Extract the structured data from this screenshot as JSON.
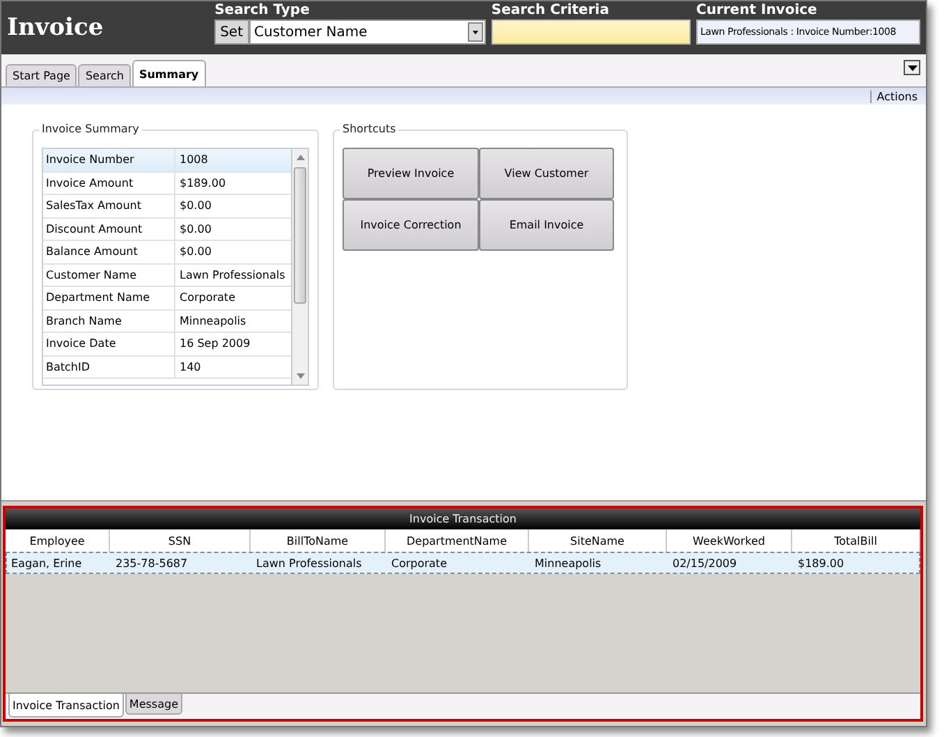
{
  "header": {
    "title": "Invoice",
    "search_type": {
      "label": "Search Type",
      "set_button": "Set",
      "value": "Customer Name"
    },
    "search_criteria": {
      "label": "Search Criteria"
    },
    "current_invoice": {
      "label": "Current Invoice",
      "value": "Lawn Professionals : Invoice Number:1008"
    }
  },
  "tabs": [
    {
      "label": "Start Page",
      "selected": false
    },
    {
      "label": "Search",
      "selected": false
    },
    {
      "label": "Summary",
      "selected": true
    }
  ],
  "actions_label": "Actions",
  "invoice_summary": {
    "title": "Invoice Summary",
    "rows": [
      {
        "name": "Invoice Number",
        "value": "1008",
        "selected": true
      },
      {
        "name": "Invoice Amount",
        "value": "$189.00",
        "selected": false
      },
      {
        "name": "SalesTax Amount",
        "value": "$0.00",
        "selected": false
      },
      {
        "name": "Discount Amount",
        "value": "$0.00",
        "selected": false
      },
      {
        "name": "Balance Amount",
        "value": "$0.00",
        "selected": false
      },
      {
        "name": "Customer Name",
        "value": "Lawn Professionals",
        "selected": false
      },
      {
        "name": "Department Name",
        "value": "Corporate",
        "selected": false
      },
      {
        "name": "Branch Name",
        "value": "Minneapolis",
        "selected": false
      },
      {
        "name": "Invoice Date",
        "value": "16 Sep 2009",
        "selected": false
      },
      {
        "name": "BatchID",
        "value": "140",
        "selected": false
      }
    ]
  },
  "shortcuts": {
    "title": "Shortcuts",
    "buttons": [
      "Preview Invoice",
      "View Customer",
      "Invoice Correction",
      "Email Invoice"
    ]
  },
  "transactions": {
    "title": "Invoice Transaction",
    "columns": [
      "Employee",
      "SSN",
      "BillToName",
      "DepartmentName",
      "SiteName",
      "WeekWorked",
      "TotalBill"
    ],
    "rows": [
      {
        "cells": [
          "Eagan, Erine",
          "235-78-5687",
          "Lawn Professionals",
          "Corporate",
          "Minneapolis",
          "02/15/2009",
          "$189.00"
        ],
        "selected": true
      }
    ]
  },
  "bottom_tabs": [
    {
      "label": "Invoice Transaction",
      "selected": true
    },
    {
      "label": "Message",
      "selected": false
    }
  ]
}
